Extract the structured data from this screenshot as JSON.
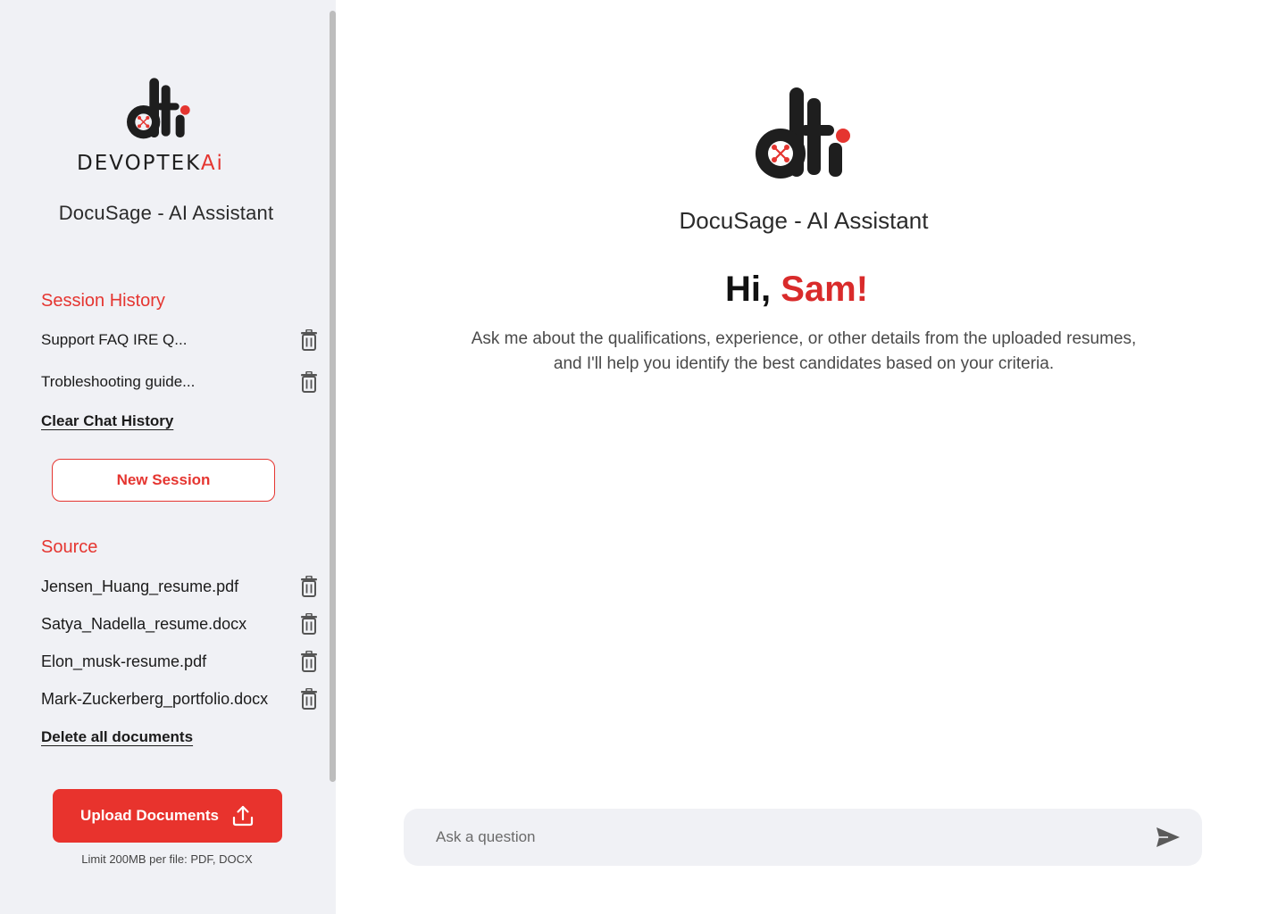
{
  "sidebar": {
    "brand_wordmark": "DEVOPTEK",
    "brand_wordmark_ai": "Ai",
    "app_title": "DocuSage - AI Assistant",
    "session_history": {
      "title": "Session History",
      "items": [
        {
          "label": "Support FAQ IRE Q..."
        },
        {
          "label": "Trobleshooting guide..."
        }
      ],
      "clear_label": "Clear Chat History"
    },
    "new_session_label": "New Session",
    "source": {
      "title": "Source",
      "items": [
        {
          "label": "Jensen_Huang_resume.pdf"
        },
        {
          "label": "Satya_Nadella_resume.docx"
        },
        {
          "label": "Elon_musk-resume.pdf"
        },
        {
          "label": "Mark-Zuckerberg_portfolio.docx"
        }
      ],
      "delete_all_label": "Delete all documents"
    },
    "upload_label": "Upload Documents",
    "upload_hint": "Limit 200MB per file: PDF, DOCX"
  },
  "main": {
    "app_title": "DocuSage - AI Assistant",
    "greeting_prefix": "Hi,",
    "greeting_name": "Sam!",
    "intro_line1": "Ask me about the qualifications, experience, or other details from the uploaded resumes,",
    "intro_line2": "and I'll help you identify the best candidates based on your criteria.",
    "chat_placeholder": "Ask a question"
  },
  "colors": {
    "accent": "#e53530",
    "sidebar_bg": "#f0f1f5",
    "text": "#1b1b1b"
  },
  "icons": [
    "trash-icon",
    "upload-icon",
    "send-icon",
    "dti-logo-icon"
  ]
}
